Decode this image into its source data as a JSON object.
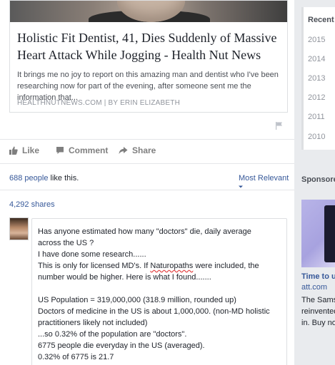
{
  "post": {
    "link": {
      "title": "Holistic Fit Dentist, 41, Dies Suddenly of Massive Heart Attack While Jogging - Health Nut News",
      "description": "It brings me no joy to report on this amazing man and dentist who I've been researching now for part of the evening, after someone sent me the information that...",
      "source": "HEALTHNUTNEWS.COM | BY ERIN ELIZABETH"
    },
    "actions": {
      "like": "Like",
      "comment": "Comment",
      "share": "Share"
    },
    "likes": {
      "count": "688 people",
      "suffix": " like this."
    },
    "sort_label": "Most Relevant",
    "shares": "4,292 shares",
    "comment": {
      "lines": [
        "Has anyone estimated how many \"doctors\" die, daily average across the US ?",
        " I have done some research......",
        " This is only for licensed MD's. If Naturopaths were included, the number would be higher. Here is what I found.......",
        "",
        "US Population = 319,000,000 (318.9 million, rounded up)",
        "Doctors of medicine in the US is about 1,000,000. (non-MD holistic practitioners likely not included)",
        "...so 0.32% of the population are \"doctors\".",
        "6775 people die everyday in the US (averaged).",
        "0.32% of 6775 is 21.7"
      ]
    }
  },
  "sidebar": {
    "years_current": "Recent",
    "years": [
      "2015",
      "2014",
      "2013",
      "2012",
      "2011",
      "2010"
    ],
    "sponsored_label": "Sponsored",
    "ad": {
      "title": "Time to up",
      "domain": "att.com",
      "body": [
        "The Samsu",
        "reinvented t",
        "in. Buy now"
      ]
    }
  }
}
